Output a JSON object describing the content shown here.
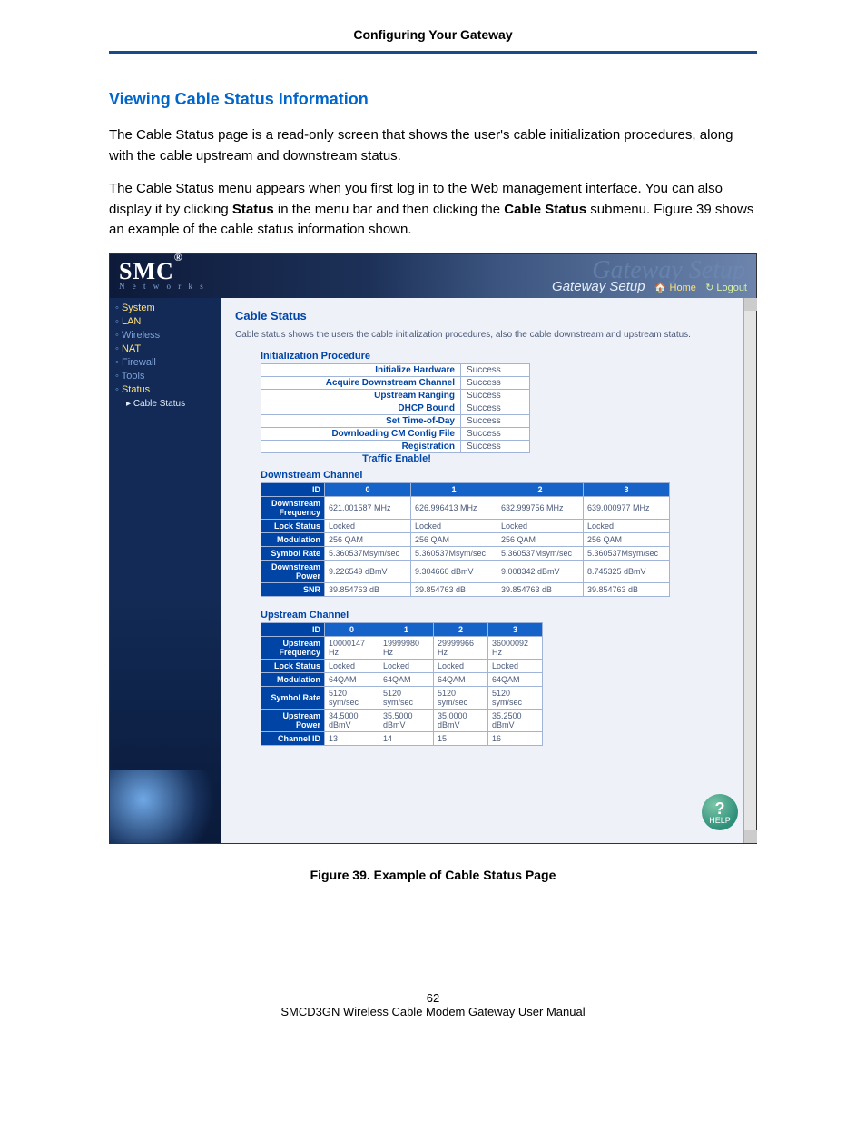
{
  "doc": {
    "header": "Configuring Your Gateway",
    "section_title": "Viewing Cable Status Information",
    "para1": "The Cable Status page is a read-only screen that shows the user's cable initialization procedures, along with the cable upstream and downstream status.",
    "para2_a": "The Cable Status menu appears when you first log in to the Web management interface. You can also display it by clicking ",
    "para2_status": "Status",
    "para2_b": " in the menu bar and then clicking the ",
    "para2_cable": "Cable Status",
    "para2_c": " submenu. Figure 39 shows an example of the cable status information shown.",
    "figure_caption": "Figure 39. Example of Cable Status Page",
    "page_number": "62",
    "footer": "SMCD3GN Wireless Cable Modem Gateway User Manual"
  },
  "ui": {
    "logo_text": "SMC",
    "logo_sub": "N e t w o r k s",
    "banner_bg": "Gateway Setup",
    "banner_sub": "Gateway Setup",
    "home": "Home",
    "logout": "Logout",
    "sidebar": [
      {
        "label": "System",
        "cls": "a"
      },
      {
        "label": "LAN",
        "cls": "a"
      },
      {
        "label": "Wireless",
        "cls": "dim"
      },
      {
        "label": "NAT",
        "cls": "a"
      },
      {
        "label": "Firewall",
        "cls": "dim"
      },
      {
        "label": "Tools",
        "cls": "dim"
      },
      {
        "label": "Status",
        "cls": "a"
      },
      {
        "label": "Cable Status",
        "cls": "sub"
      }
    ],
    "content_title": "Cable Status",
    "content_desc": "Cable status shows the users the cable initialization procedures, also the cable downstream and upstream status.",
    "init_label": "Initialization Procedure",
    "init_rows": [
      {
        "label": "Initialize Hardware",
        "value": "Success"
      },
      {
        "label": "Acquire Downstream Channel",
        "value": "Success"
      },
      {
        "label": "Upstream Ranging",
        "value": "Success"
      },
      {
        "label": "DHCP Bound",
        "value": "Success"
      },
      {
        "label": "Set Time-of-Day",
        "value": "Success"
      },
      {
        "label": "Downloading CM Config File",
        "value": "Success"
      },
      {
        "label": "Registration",
        "value": "Success"
      }
    ],
    "traffic": "Traffic Enable!",
    "help": "HELP"
  },
  "chart_data": [
    {
      "type": "table",
      "title": "Downstream Channel",
      "columns": [
        "ID",
        "0",
        "1",
        "2",
        "3"
      ],
      "rows": [
        {
          "label": "Downstream Frequency",
          "cells": [
            "621.001587 MHz",
            "626.996413 MHz",
            "632.999756 MHz",
            "639.000977 MHz"
          ]
        },
        {
          "label": "Lock Status",
          "cells": [
            "Locked",
            "Locked",
            "Locked",
            "Locked"
          ]
        },
        {
          "label": "Modulation",
          "cells": [
            "256 QAM",
            "256 QAM",
            "256 QAM",
            "256 QAM"
          ]
        },
        {
          "label": "Symbol Rate",
          "cells": [
            "5.360537Msym/sec",
            "5.360537Msym/sec",
            "5.360537Msym/sec",
            "5.360537Msym/sec"
          ]
        },
        {
          "label": "Downstream Power",
          "cells": [
            "9.226549 dBmV",
            "9.304660 dBmV",
            "9.008342 dBmV",
            "8.745325 dBmV"
          ]
        },
        {
          "label": "SNR",
          "cells": [
            "39.854763 dB",
            "39.854763 dB",
            "39.854763 dB",
            "39.854763 dB"
          ]
        }
      ]
    },
    {
      "type": "table",
      "title": "Upstream Channel",
      "columns": [
        "ID",
        "0",
        "1",
        "2",
        "3"
      ],
      "rows": [
        {
          "label": "Upstream Frequency",
          "cells": [
            "10000147 Hz",
            "19999980 Hz",
            "29999966 Hz",
            "36000092 Hz"
          ]
        },
        {
          "label": "Lock Status",
          "cells": [
            "Locked",
            "Locked",
            "Locked",
            "Locked"
          ]
        },
        {
          "label": "Modulation",
          "cells": [
            "64QAM",
            "64QAM",
            "64QAM",
            "64QAM"
          ]
        },
        {
          "label": "Symbol Rate",
          "cells": [
            "5120 sym/sec",
            "5120 sym/sec",
            "5120 sym/sec",
            "5120 sym/sec"
          ]
        },
        {
          "label": "Upstream Power",
          "cells": [
            "34.5000 dBmV",
            "35.5000 dBmV",
            "35.0000 dBmV",
            "35.2500 dBmV"
          ]
        },
        {
          "label": "Channel ID",
          "cells": [
            "13",
            "14",
            "15",
            "16"
          ]
        }
      ]
    }
  ]
}
